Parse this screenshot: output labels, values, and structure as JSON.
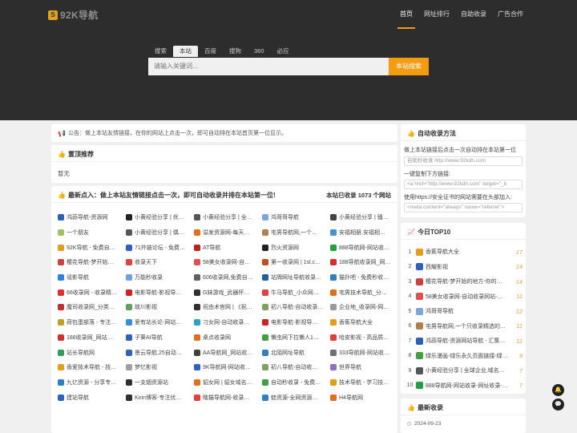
{
  "brand": {
    "name": "92K导航",
    "mark": "S"
  },
  "nav": [
    {
      "label": "首页"
    },
    {
      "label": "网址排行"
    },
    {
      "label": "自助收录"
    },
    {
      "label": "广告合作"
    }
  ],
  "search": {
    "tabs": [
      {
        "label": "搜索"
      },
      {
        "label": "本站"
      },
      {
        "label": "百度"
      },
      {
        "label": "搜狗"
      },
      {
        "label": "360"
      },
      {
        "label": "必应"
      }
    ],
    "placeholder": "请输入关键词...",
    "button": "本站搜索"
  },
  "notice": {
    "text": "公告：做上本站友情链接，在你的网站上点击一次，即可自动排在本站首页第一位显示。"
  },
  "pinned": {
    "title": "置顶推荐",
    "empty": "暂无"
  },
  "newest": {
    "title": "最新点入：做上本站友情链接点击一次，即可自动收录并排在本站第一位!",
    "count": "本站已收录 1073 个网站"
  },
  "sites": [
    {
      "name": "鸿蒜导航-资源网",
      "color": "#2b5fb8"
    },
    {
      "name": "小黄经验分享 | 优…",
      "color": "#222"
    },
    {
      "name": "小黄经验分享 | 全…",
      "color": "#555"
    },
    {
      "name": "鸿哥哥导航",
      "color": "#7aa7e0"
    },
    {
      "name": "小黄经验分享 | 骚…",
      "color": "#444"
    },
    {
      "name": "一个朋友",
      "color": "#a0c060"
    },
    {
      "name": "小黄经验分享 | 偶…",
      "color": "#555"
    },
    {
      "name": "溢发资源网-每天…",
      "color": "#e07020"
    },
    {
      "name": "宅男导航网,一个…",
      "color": "#b08050"
    },
    {
      "name": "安福相册,安福相…",
      "color": "#4a90d0"
    },
    {
      "name": "92K导航 - 免费自…",
      "color": "#e0a01c"
    },
    {
      "name": "71外链论坛 - 免费…",
      "color": "#3060c0"
    },
    {
      "name": "AT导航",
      "color": "#c02020"
    },
    {
      "name": "烈火资源网",
      "color": "#222"
    },
    {
      "name": "888导航网-网站收…",
      "color": "#20a040"
    },
    {
      "name": "樱花导航-梦开始…",
      "color": "#d04040"
    },
    {
      "name": "收录天下",
      "color": "#e04040"
    },
    {
      "name": "58美女收录网-自…",
      "color": "#e05050"
    },
    {
      "name": "第一收录网 | 1sl.c…",
      "color": "#c05020"
    },
    {
      "name": "188导航收录网_网…",
      "color": "#d03030"
    },
    {
      "name": "谣影导航",
      "color": "#3080e0"
    },
    {
      "name": "万能秒收录",
      "color": "#70a0e0"
    },
    {
      "name": "606收录网,免费自…",
      "color": "#606060"
    },
    {
      "name": "站牌网址导航收录…",
      "color": "#2060a0"
    },
    {
      "name": "猫扑吧 - 免费秒收…",
      "color": "#3080c0"
    },
    {
      "name": "66收录网 - 收录精…",
      "color": "#e03030"
    },
    {
      "name": "电影导航-影视导…",
      "color": "#d02020"
    },
    {
      "name": "G妹游戏_武器怀…",
      "color": "#303030"
    },
    {
      "name": "牛马导航_小众网…",
      "color": "#e04040"
    },
    {
      "name": "宅男技术导航_分…",
      "color": "#e07020"
    },
    {
      "name": "魔司收录网_分类…",
      "color": "#c03030"
    },
    {
      "name": "故川影视",
      "color": "#60a060"
    },
    {
      "name": "祝由术官网 | 《祝…",
      "color": "#303030"
    },
    {
      "name": "初八导航-自动收录…",
      "color": "#80a060"
    },
    {
      "name": "企业地_收录网-网…",
      "color": "#999"
    },
    {
      "name": "荷包蛋部落 - 专注…",
      "color": "#c0a020"
    },
    {
      "name": "爱有站长论-网站…",
      "color": "#3090e0"
    },
    {
      "name": "刁女网-自动收录…",
      "color": "#30a0c0"
    },
    {
      "name": "电影导航-影视导…",
      "color": "#d02020"
    },
    {
      "name": "香蕉导航大全",
      "color": "#e0a01c"
    },
    {
      "name": "188收录网_网站…",
      "color": "#d03030"
    },
    {
      "name": "子葵AI导航",
      "color": "#3060c0"
    },
    {
      "name": "桌点收录网",
      "color": "#e07020"
    },
    {
      "name": "懒虫网下拉懒人1…",
      "color": "#40a040"
    },
    {
      "name": "哈皮影视 - 高品质…",
      "color": "#e04040"
    },
    {
      "name": "站长导航网",
      "color": "#30a060"
    },
    {
      "name": "景云导航,25自动…",
      "color": "#3060c0"
    },
    {
      "name": "AA导航网_网站收…",
      "color": "#404040"
    },
    {
      "name": "北陌网址导航",
      "color": "#3080c0"
    },
    {
      "name": "333导航网-网站收…",
      "color": "#707070"
    },
    {
      "name": "香爱技术导航 - 技…",
      "color": "#e0a01c"
    },
    {
      "name": "梦忆影视",
      "color": "#a0a0a0"
    },
    {
      "name": "9K导航网-网站收…",
      "color": "#3060c0"
    },
    {
      "name": "初八导航-自动收…",
      "color": "#80a060"
    },
    {
      "name": "世界导航",
      "color": "#9070c0"
    },
    {
      "name": "九亿资源 - 分享专…",
      "color": "#3080c0"
    },
    {
      "name": "一支烟资源站",
      "color": "#303030"
    },
    {
      "name": "貂女网 | 貂女域名…",
      "color": "#e07020"
    },
    {
      "name": "自动秒收录 - 免费…",
      "color": "#40a040"
    },
    {
      "name": "技术导航 - 学习技…",
      "color": "#e0a01c"
    },
    {
      "name": "建站导航",
      "color": "#3060c0"
    },
    {
      "name": "Kirin博客-专注优…",
      "color": "#303030"
    },
    {
      "name": "瞎猫导航网-收录…",
      "color": "#e04040"
    },
    {
      "name": "蛙资源-全网资源…",
      "color": "#3080c0"
    },
    {
      "name": "H4导航网",
      "color": "#e07020"
    }
  ],
  "howto": {
    "title": "自动收录方法",
    "line1": "做上本站链接后点击一次自动排在本站第一位",
    "placeholder1": "自助秒收录 http://www.92kdh.com",
    "line2": "一键复制下方链接:",
    "code": "<a href=\"http://www.92kdh.com\" target=\"_b",
    "line3": "使用https://安全证书的网站需要在头部加入:",
    "meta": "<meta content=\"always\" name=\"referrer\">"
  },
  "top10": {
    "title": "今日TOP10",
    "items": [
      {
        "rank": "1",
        "name": "香蕉导航大全",
        "count": "17",
        "color": "#e0a01c"
      },
      {
        "rank": "2",
        "name": "西耀影视",
        "count": "14",
        "color": "#3060c0"
      },
      {
        "rank": "3",
        "name": "樱花导航-梦开始的地方-你的…",
        "count": "14",
        "color": "#d04040"
      },
      {
        "rank": "4",
        "name": "58美女收录网-自动收录网站-…",
        "count": "11",
        "color": "#e05050"
      },
      {
        "rank": "5",
        "name": "鸿哥哥导航",
        "count": "12",
        "color": "#7aa7e0"
      },
      {
        "rank": "6",
        "name": "宅男导航网,一个只收录精选的…",
        "count": "11",
        "color": "#b08050"
      },
      {
        "rank": "7",
        "name": "鸿蒜导航-资源网站导航 - 汇集…",
        "count": "11",
        "color": "#2b5fb8"
      },
      {
        "rank": "8",
        "name": "绿乐漫画-绿乐永久页面链接-绿…",
        "count": "9",
        "color": "#40a040"
      },
      {
        "rank": "9",
        "name": "小黄经验分享 | 全球企业,域名…",
        "count": "7",
        "color": "#555"
      },
      {
        "rank": "10",
        "name": "888导航网-网站收录-网址收录-…",
        "count": "7",
        "color": "#20a040"
      }
    ]
  },
  "recent": {
    "title": "最新收录",
    "date": "2024-09-23"
  },
  "floaters": [
    {
      "icon": "bell-icon"
    },
    {
      "icon": "chat-icon"
    }
  ]
}
